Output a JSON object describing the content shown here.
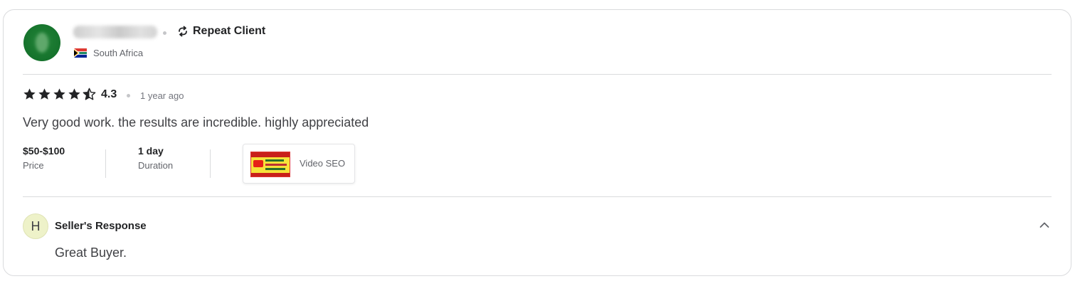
{
  "reviewer": {
    "username_obscured": true,
    "badge_label": "Repeat Client",
    "badge_icon": "repeat-icon",
    "country": "South Africa",
    "country_flag_icon": "south-africa-flag-icon",
    "avatar_color": "#1b7a31"
  },
  "review": {
    "rating": 4.3,
    "rating_label": "4.3",
    "stars_total": 5,
    "time_ago": "1 year ago",
    "text": "Very good work. the results are incredible. highly appreciated"
  },
  "meta": {
    "price_value": "$50-$100",
    "price_label": "Price",
    "duration_value": "1 day",
    "duration_label": "Duration"
  },
  "gig": {
    "title": "Video SEO",
    "thumbnail_icon": "youtube-marketing-thumbnail"
  },
  "seller_response": {
    "avatar_letter": "H",
    "avatar_color": "#eef2c9",
    "title": "Seller's Response",
    "text": "Great Buyer.",
    "toggle_icon": "chevron-up-icon"
  },
  "colors": {
    "text_dark": "#222325",
    "text_body": "#404145",
    "text_muted": "#62646a",
    "border": "#dadbdd"
  }
}
